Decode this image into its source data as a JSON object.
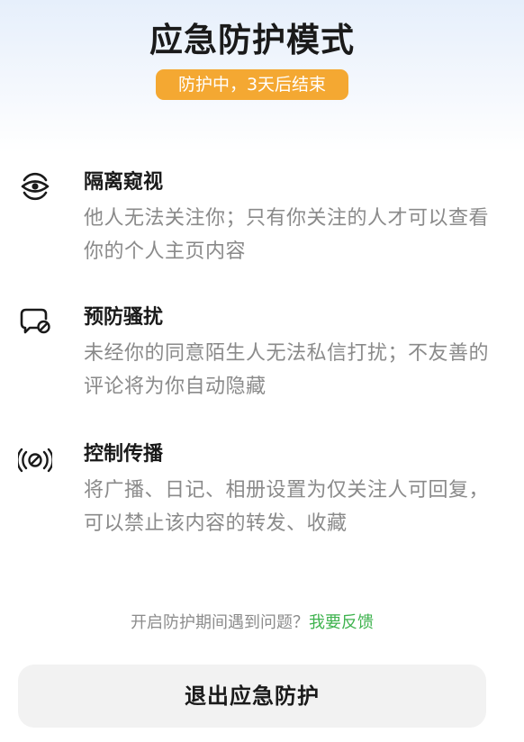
{
  "header": {
    "title": "应急防护模式",
    "badge": "防护中，3天后结束"
  },
  "features": [
    {
      "icon": "eye-icon",
      "title": "隔离窥视",
      "description": "他人无法关注你；只有你关注的人才可以查看你的个人主页内容"
    },
    {
      "icon": "message-block-icon",
      "title": "预防骚扰",
      "description": "未经你的同意陌生人无法私信打扰；不友善的评论将为你自动隐藏"
    },
    {
      "icon": "broadcast-block-icon",
      "title": "控制传播",
      "description": "将广播、日记、相册设置为仅关注人可回复，可以禁止该内容的转发、收藏"
    }
  ],
  "footer": {
    "question": "开启防护期间遇到问题？",
    "feedback_link": "我要反馈",
    "exit_button": "退出应急防护"
  },
  "colors": {
    "badge_bg": "#f4a832",
    "link": "#3fb34f",
    "button_bg": "#f2f2f2"
  }
}
